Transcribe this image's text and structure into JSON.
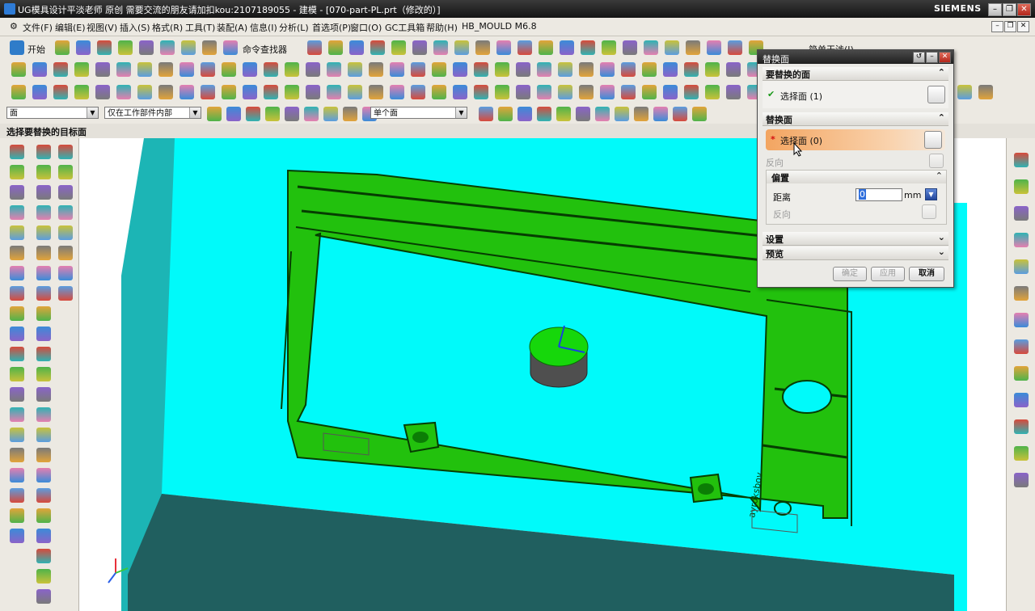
{
  "window": {
    "title": "UG模具设计平淡老师 原创 需要交流的朋友请加扣kou:2107189055 - 建模 - [070-part-PL.prt（修改的）]",
    "brand": "SIEMENS",
    "controls": {
      "minimize": "–",
      "restore": "❐",
      "close": "✕"
    }
  },
  "menubar": {
    "items": [
      "文件(F)",
      "编辑(E)",
      "视图(V)",
      "插入(S)",
      "格式(R)",
      "工具(T)",
      "装配(A)",
      "信息(I)",
      "分析(L)",
      "首选项(P)",
      "窗口(O)",
      "GC工具箱",
      "帮助(H)",
      "HB_MOULD M6.8"
    ],
    "mdi_controls": [
      "–",
      "❐",
      "✕"
    ]
  },
  "toolbar": {
    "start_label": "开始",
    "command_finder_label": "命令查找器",
    "simple_label": "简单干涉(I)"
  },
  "selection_bar": {
    "filter_value": "面",
    "scope_value": "仅在工作部件内部",
    "face_rule_value": "单个面"
  },
  "cue_line": "选择要替换的目标面",
  "dialog": {
    "title": "替换面",
    "section_target": {
      "title": "要替换的面",
      "select_label": "选择面 (1)",
      "check": "✔"
    },
    "section_replacement": {
      "title": "替换面",
      "select_label": "选择面 (0)",
      "required_mark": "*",
      "reverse_label": "反向"
    },
    "offset": {
      "title": "偏置",
      "distance_label": "距离",
      "distance_value": "0",
      "unit": "mm",
      "reverse_label": "反向"
    },
    "settings_title": "设置",
    "preview_title": "预览",
    "buttons": {
      "ok": "确定",
      "apply": "应用",
      "cancel": "取消"
    }
  },
  "model": {
    "part_text": "ayroksbov",
    "colors": {
      "mold_plate": "#00fafa",
      "mold_side": "#1cb5b5",
      "mold_bottom": "#205f5f",
      "part": "#22c10d",
      "part_edge": "#063d02",
      "boss": "#4f4f4f",
      "boss_top": "#16d70b"
    }
  }
}
